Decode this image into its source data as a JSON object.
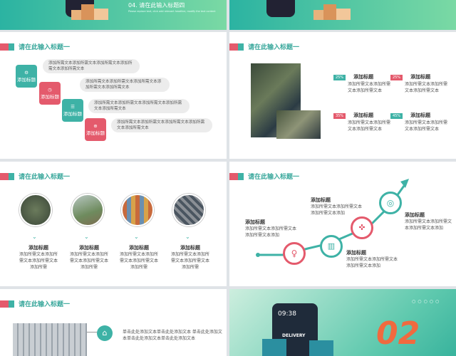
{
  "section_label": "请在此输入标题一",
  "top_left": {
    "title": "04. 请在此输入标题四",
    "subtitle": "Please replace text, click add relevant headline, modify the text content"
  },
  "slide_a": {
    "items": [
      {
        "label": "添加标题",
        "text": "添加所需文本添加所需文本添加所需文本添加所需文本添加所需文本"
      },
      {
        "label": "添加标题",
        "text": "添加所需文本添加所需文本添加所需文本添加所需文本添加所需文本"
      },
      {
        "label": "添加标题",
        "text": "添加所需文本添加所需文本添加所需文本添加所需文本添加所需文本"
      },
      {
        "label": "添加标题",
        "text": "添加所需文本添加所需文本添加所需文本添加所需文本添加所需文本"
      }
    ]
  },
  "slide_b": {
    "items": [
      {
        "pct": "25%",
        "title": "添加标题",
        "text": "添加所需文本添加所需文本添加所需文本"
      },
      {
        "pct": "25%",
        "title": "添加标题",
        "text": "添加所需文本添加所需文本添加所需文本"
      },
      {
        "pct": "35%",
        "title": "添加标题",
        "text": "添加所需文本添加所需文本添加所需文本"
      },
      {
        "pct": "45%",
        "title": "添加标题",
        "text": "添加所需文本添加所需文本添加所需文本"
      }
    ]
  },
  "slide_c": {
    "items": [
      {
        "title": "添加标题",
        "text": "添加所需文本添加所需文本添加所需文本添加所需"
      },
      {
        "title": "添加标题",
        "text": "添加所需文本添加所需文本添加所需文本添加所需"
      },
      {
        "title": "添加标题",
        "text": "添加所需文本添加所需文本添加所需文本添加所需"
      },
      {
        "title": "添加标题",
        "text": "添加所需文本添加所需文本添加所需文本添加所需"
      }
    ]
  },
  "slide_d": {
    "items": [
      {
        "title": "添加标题",
        "text": "添加所需文本添加所需文本添加所需文本添加"
      },
      {
        "title": "添加标题",
        "text": "添加所需文本添加所需文本添加所需文本添加"
      },
      {
        "title": "添加标题",
        "text": "添加所需文本添加所需文本添加所需文本添加"
      },
      {
        "title": "添加标题",
        "text": "添加所需文本添加所需文本添加所需文本添加"
      }
    ]
  },
  "slide_e": {
    "text": "单击此处添加文本单击此处添加文本 单击此处添加文本单击此处添加文本单击此处添加文本"
  },
  "slide_f": {
    "number": "02",
    "phone_time": "09:38",
    "phone_label": "DELIVERY"
  },
  "colors": {
    "teal": "#3eb2a6",
    "red": "#e45a6c"
  }
}
